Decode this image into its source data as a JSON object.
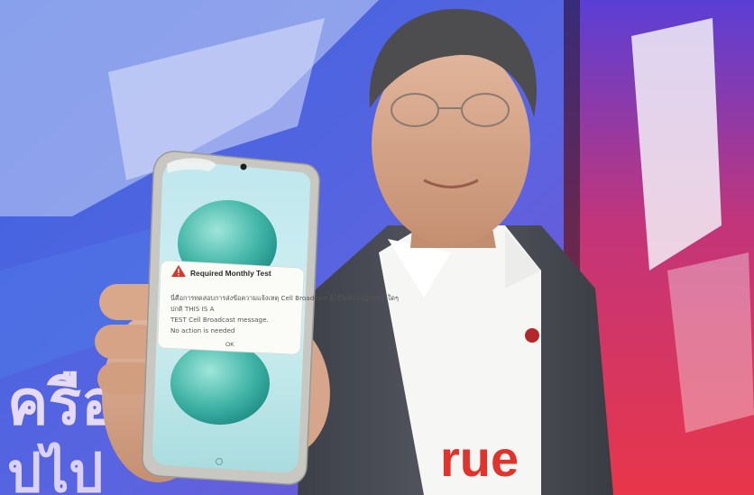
{
  "photo": {
    "backdrop_letters": "ครือ",
    "backdrop_letters_2": "ปไป",
    "shirt_logo": "rue"
  },
  "dialog": {
    "title": "Required Monthly Test",
    "body": "นี่คือการทดสอบการส่งข้อความแจ้งเหตุ Cell Broadcast ผู้ใช้ไม่ต้องปฏิบัติการใดๆ ปกติ THIS IS A TEST Cell Broadcast message. No action is needed",
    "ok_label": "OK"
  },
  "colors": {
    "backdrop_blue": "#2c56d9",
    "backdrop_red": "#e2384e",
    "alert_red": "#d9362c",
    "jacket": "#4a4d55"
  }
}
